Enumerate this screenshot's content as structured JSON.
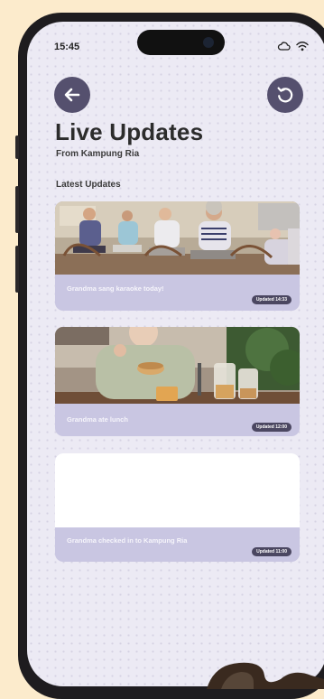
{
  "status_bar": {
    "time": "15:45",
    "icons": [
      "cloud-icon",
      "wifi-icon"
    ]
  },
  "header": {
    "back_icon": "arrow-left-icon",
    "refresh_icon": "refresh-icon",
    "title": "Live Updates",
    "subtitle": "From Kampung Ria"
  },
  "section_label": "Latest Updates",
  "updates": [
    {
      "caption": "Grandma sang karaoke today!",
      "badge": "Updated 14:33",
      "image": "seniors exercising in chairs"
    },
    {
      "caption": "Grandma ate lunch",
      "badge": "Updated 12:00",
      "image": "elderly woman eating in kitchen"
    },
    {
      "caption": "Grandma checked in to Kampung Ria",
      "badge": "Updated 11:00",
      "image": ""
    }
  ],
  "colors": {
    "accent": "#55506e",
    "card": "#c9c6e2",
    "background": "#fcebcc",
    "screen": "#eceaf4"
  }
}
